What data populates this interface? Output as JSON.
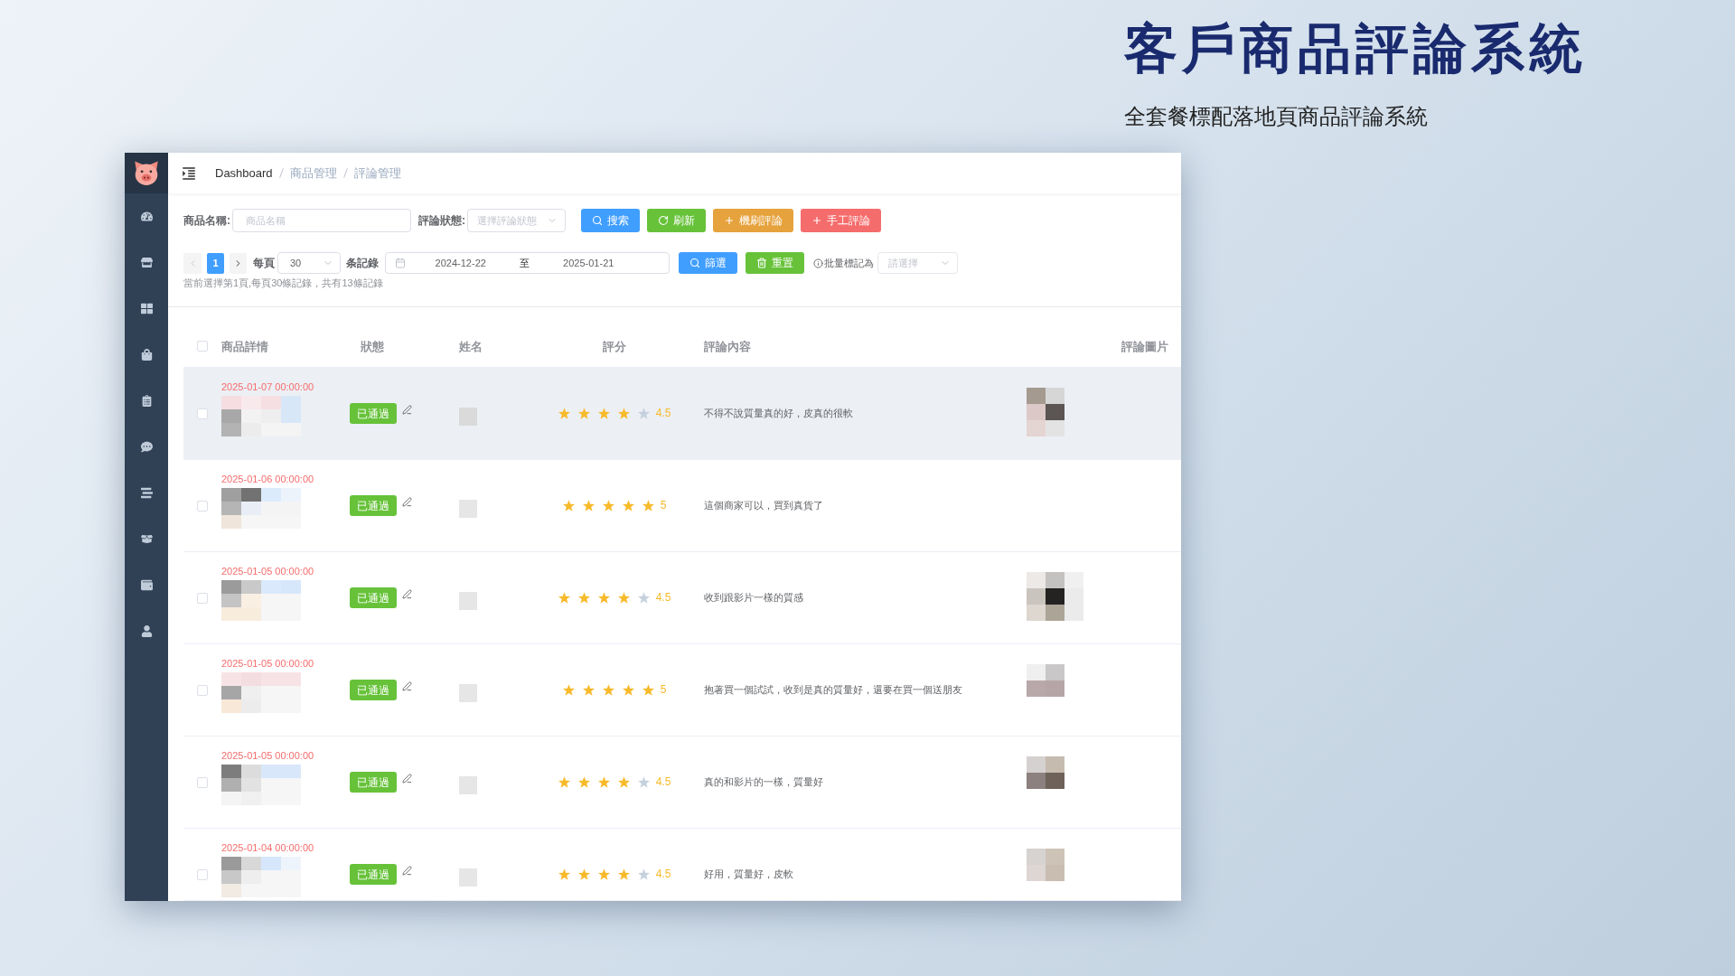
{
  "hero": {
    "title": "客戶商品評論系統",
    "subtitle": "全套餐標配落地頁商品評論系統"
  },
  "breadcrumb": [
    "Dashboard",
    "商品管理",
    "評論管理"
  ],
  "search_bar": {
    "fields": [
      {
        "kind": "input",
        "label": "商品名稱:",
        "placeholder": "商品名稱"
      },
      {
        "kind": "select",
        "label": "評論狀態:",
        "placeholder": "選擇評論狀態"
      }
    ],
    "buttons": [
      {
        "kind": "search",
        "label": "搜索"
      },
      {
        "kind": "refresh",
        "label": "刷新"
      },
      {
        "kind": "auto",
        "label": "機刷評論"
      },
      {
        "kind": "manual",
        "label": "手工評論"
      }
    ]
  },
  "pager": {
    "prev": {
      "disabled": true
    },
    "pages": [
      {
        "label": "1",
        "selected": true
      }
    ],
    "next": {
      "disabled": false
    },
    "per_page_label": "每頁",
    "per_page": "30",
    "records_label": "条記錄",
    "summary": "當前選擇第1頁,每頁30條記錄，共有13條記錄"
  },
  "date_range": {
    "start": "2024-12-22",
    "separator": "至",
    "end": "2025-01-21"
  },
  "filter_buttons": [
    {
      "kind": "filter",
      "label": "篩選"
    },
    {
      "kind": "reset",
      "label": "重置"
    }
  ],
  "batch_mark": {
    "label": "批量標記為",
    "placeholder": "請選擇"
  },
  "table": {
    "select_all": {
      "checked": false
    },
    "columns": [
      "商品詳情",
      "狀態",
      "姓名",
      "評分",
      "評論內容",
      "評論圖片"
    ],
    "rows": [
      {
        "date": "2025-01-07 00:00:00",
        "checked": false,
        "highlighted": true,
        "status": "已通過",
        "stars": 4,
        "score": "4.5",
        "comment": "不得不說質量真的好，皮真的很軟",
        "review_image": true
      },
      {
        "date": "2025-01-06 00:00:00",
        "checked": false,
        "highlighted": false,
        "status": "已通過",
        "stars": 5,
        "score": "5",
        "comment": "這個商家可以，買到真貨了",
        "review_image": false
      },
      {
        "date": "2025-01-05 00:00:00",
        "checked": false,
        "highlighted": false,
        "status": "已通過",
        "stars": 4,
        "score": "4.5",
        "comment": "收到跟影片一樣的質感",
        "review_image": true
      },
      {
        "date": "2025-01-05 00:00:00",
        "checked": false,
        "highlighted": false,
        "status": "已通過",
        "stars": 5,
        "score": "5",
        "comment": "抱著買一個試試，收到是真的質量好，還要在買一個送朋友",
        "review_image": true
      },
      {
        "date": "2025-01-05 00:00:00",
        "checked": false,
        "highlighted": false,
        "status": "已通過",
        "stars": 4,
        "score": "4.5",
        "comment": "真的和影片的一樣，質量好",
        "review_image": true
      },
      {
        "date": "2025-01-04 00:00:00",
        "checked": false,
        "highlighted": false,
        "status": "已通過",
        "stars": 4,
        "score": "4.5",
        "comment": "好用，質量好，皮軟",
        "review_image": true
      }
    ]
  }
}
